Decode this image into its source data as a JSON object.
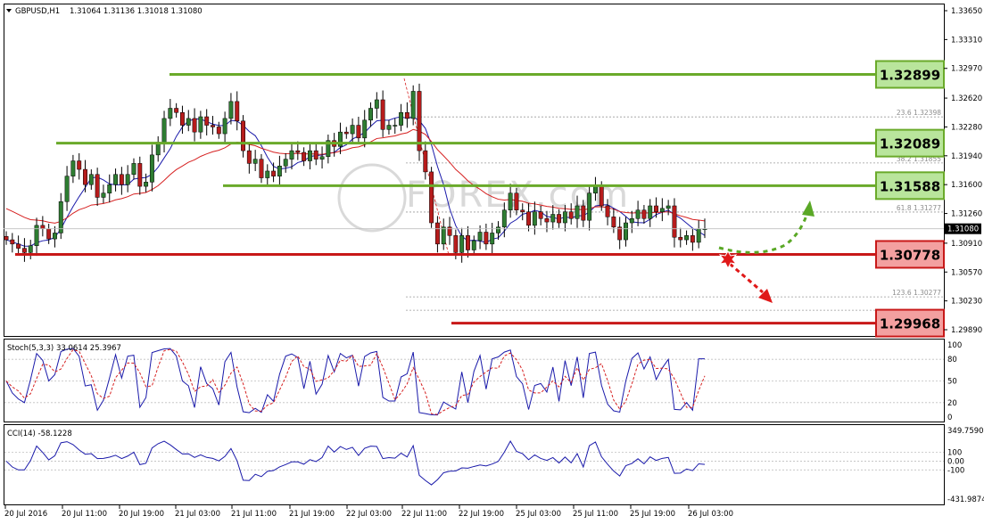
{
  "header": {
    "symbol": "GBPUSD,H1",
    "ohlc": "1.31064 1.31136 1.31018 1.31080"
  },
  "price_axis": {
    "ticks": [
      "1.33650",
      "1.33310",
      "1.32970",
      "1.32620",
      "1.32280",
      "1.31940",
      "1.31600",
      "1.31260",
      "1.30910",
      "1.30570",
      "1.30230",
      "1.29890"
    ],
    "current_price": "1.31080"
  },
  "time_axis": {
    "labels": [
      "20 Jul 2016",
      "20 Jul 11:00",
      "20 Jul 19:00",
      "21 Jul 03:00",
      "21 Jul 11:00",
      "21 Jul 19:00",
      "22 Jul 03:00",
      "22 Jul 11:00",
      "22 Jul 19:00",
      "25 Jul 03:00",
      "25 Jul 11:00",
      "25 Jul 19:00",
      "26 Jul 03:00"
    ]
  },
  "levels": {
    "resistance": [
      "1.32899",
      "1.32089",
      "1.31588"
    ],
    "support": [
      "1.30778",
      "1.29968"
    ]
  },
  "fib_labels": [
    "23.6  1.32398",
    "38.2  1.31855",
    "61.8  1.31277",
    "123.6  1.30277"
  ],
  "watermark": "FOREX.com",
  "stoch": {
    "label": "Stoch(5,3,3) 33.0614 25.3967",
    "ticks": [
      "100",
      "80",
      "50",
      "20",
      "0"
    ]
  },
  "cci": {
    "label": "CCI(14) -58.1228",
    "ticks": [
      "349.7590",
      "100",
      "0.00",
      "-100",
      "-431.9874"
    ]
  },
  "colors": {
    "bull": "#2e7d32",
    "bear": "#b71c1c",
    "ma_fast": "#1a1aaa",
    "ma_slow": "#d62020",
    "resistance": "#6aaa2a",
    "support": "#c81818",
    "resistance_box": "#b9e59c",
    "support_box": "#f3a0a0"
  },
  "chart_data": {
    "type": "candlestick",
    "title": "GBPUSD,H1",
    "ylim": [
      1.2975,
      1.3375
    ],
    "price_ticks": [
      1.3365,
      1.3331,
      1.3297,
      1.3262,
      1.3228,
      1.3194,
      1.316,
      1.3126,
      1.3091,
      1.3057,
      1.3023,
      1.2989
    ],
    "time_labels": [
      "20 Jul 2016",
      "20 Jul 11:00",
      "20 Jul 19:00",
      "21 Jul 03:00",
      "21 Jul 11:00",
      "21 Jul 19:00",
      "22 Jul 03:00",
      "22 Jul 11:00",
      "22 Jul 19:00",
      "25 Jul 03:00",
      "25 Jul 11:00",
      "25 Jul 19:00",
      "26 Jul 03:00"
    ],
    "close_series": [
      1.3095,
      1.309,
      1.3085,
      1.308,
      1.3088,
      1.3112,
      1.3108,
      1.3096,
      1.3103,
      1.314,
      1.317,
      1.3188,
      1.3178,
      1.316,
      1.3172,
      1.3145,
      1.315,
      1.316,
      1.3172,
      1.316,
      1.3172,
      1.3185,
      1.3158,
      1.3163,
      1.3195,
      1.321,
      1.3238,
      1.325,
      1.3245,
      1.323,
      1.3238,
      1.3222,
      1.324,
      1.323,
      1.3228,
      1.322,
      1.3238,
      1.3258,
      1.3235,
      1.32,
      1.3185,
      1.319,
      1.3168,
      1.3176,
      1.317,
      1.3182,
      1.319,
      1.32,
      1.3198,
      1.3188,
      1.32,
      1.319,
      1.3193,
      1.3212,
      1.3205,
      1.3222,
      1.322,
      1.323,
      1.3215,
      1.3236,
      1.325,
      1.326,
      1.3225,
      1.323,
      1.323,
      1.3245,
      1.3238,
      1.327,
      1.32,
      1.3175,
      1.3115,
      1.309,
      1.311,
      1.31,
      1.308,
      1.31,
      1.3083,
      1.3094,
      1.3104,
      1.309,
      1.3103,
      1.311,
      1.313,
      1.315,
      1.313,
      1.3128,
      1.3112,
      1.3128,
      1.312,
      1.3116,
      1.3125,
      1.3115,
      1.3128,
      1.312,
      1.3135,
      1.3118,
      1.315,
      1.3158,
      1.3135,
      1.3122,
      1.311,
      1.3095,
      1.3115,
      1.312,
      1.313,
      1.312,
      1.3135,
      1.3128,
      1.3132,
      1.3135,
      1.3098,
      1.3095,
      1.31,
      1.3092,
      1.3108,
      1.3108
    ],
    "resistance_levels": [
      1.32899,
      1.32089,
      1.31588
    ],
    "support_levels": [
      1.30778,
      1.29968
    ],
    "fib_levels": [
      {
        "ratio": 23.6,
        "value": 1.32398
      },
      {
        "ratio": 38.2,
        "value": 1.31855
      },
      {
        "ratio": 61.8,
        "value": 1.31277
      },
      {
        "ratio": 123.6,
        "value": 1.30277
      }
    ],
    "indicators": [
      {
        "name": "Stoch(5,3,3)",
        "main": 33.0614,
        "signal": 25.3967,
        "ylim": [
          0,
          100
        ],
        "levels": [
          80,
          50,
          20
        ]
      },
      {
        "name": "CCI(14)",
        "value": -58.1228,
        "ylim": [
          -431.9874,
          349.759
        ],
        "levels": [
          100,
          0,
          -100
        ]
      }
    ]
  }
}
